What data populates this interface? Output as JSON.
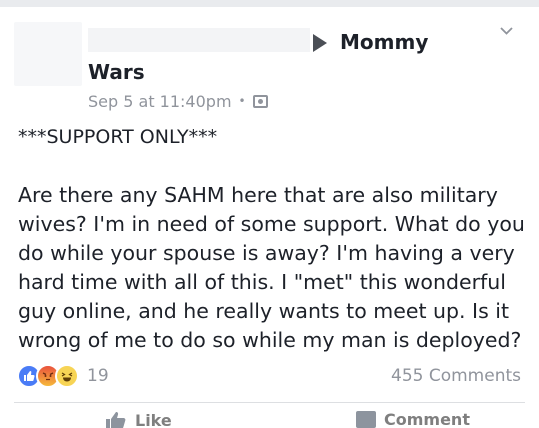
{
  "post": {
    "group_name_part1": "Mommy",
    "group_name_part2": "Wars",
    "timestamp": "Sep 5 at 11:40pm",
    "separator": "•",
    "title_line": "***SUPPORT ONLY***",
    "body": "Are there any SAHM here that are also military wives? I'm in need of some support. What do you do while your spouse is away? I'm having a very hard time with all of this. I \"met\" this wonderful guy online, and he really wants to meet up. Is it wrong of me to do so while my man is deployed?"
  },
  "engagement": {
    "reaction_count": "19",
    "comments_label": "455 Comments"
  },
  "actions": {
    "like_label": "Like",
    "comment_label": "Comment"
  },
  "icons": [
    "triangle-arrow-icon",
    "chevron-down-icon",
    "group-privacy-icon",
    "like-reaction-icon",
    "angry-reaction-icon",
    "haha-reaction-icon",
    "thumbs-up-icon",
    "comment-icon"
  ],
  "colors": {
    "like_blue": "#4a7cf6",
    "meta_gray": "#90949c",
    "text": "#1d2129"
  }
}
